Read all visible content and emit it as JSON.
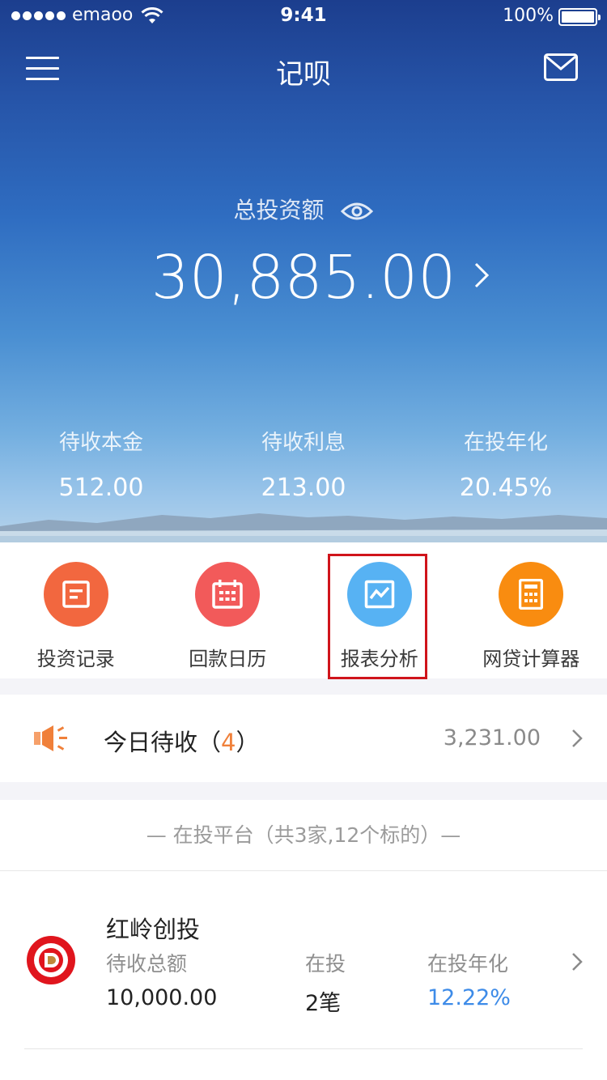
{
  "status_bar": {
    "carrier": "emaoo",
    "time": "9:41",
    "battery": "100%"
  },
  "nav": {
    "title": "记呗",
    "menu_icon": "menu-icon",
    "mail_icon": "mail-icon"
  },
  "summary": {
    "total_label": "总投资额",
    "total_amount": "30,885.00",
    "stats": [
      {
        "label": "待收本金",
        "value": "512.00"
      },
      {
        "label": "待收利息",
        "value": "213.00"
      },
      {
        "label": "在投年化",
        "value": "20.45%"
      }
    ]
  },
  "quick_actions": [
    {
      "label": "投资记录",
      "icon": "document-icon",
      "color": "#f2673f"
    },
    {
      "label": "回款日历",
      "icon": "calendar-icon",
      "color": "#f25a5a"
    },
    {
      "label": "报表分析",
      "icon": "chart-icon",
      "color": "#57b2f3",
      "highlighted": true
    },
    {
      "label": "网贷计算器",
      "icon": "calculator-icon",
      "color": "#f98c10"
    }
  ],
  "today_due": {
    "label_prefix": "今日待收（",
    "count": "4",
    "label_suffix": "）",
    "amount": "3,231.00"
  },
  "platforms": {
    "header": "—  在投平台（共3家,12个标的）—",
    "items": [
      {
        "name": "红岭创投",
        "due_label": "待收总额",
        "due_value": "10,000.00",
        "invest_label": "在投",
        "invest_value": "2笔",
        "rate_label": "在投年化",
        "rate_value": "12.22%"
      }
    ]
  },
  "colors": {
    "accent_orange": "#f0803a",
    "accent_blue": "#3d8be8",
    "highlight_red": "#d0141b"
  }
}
